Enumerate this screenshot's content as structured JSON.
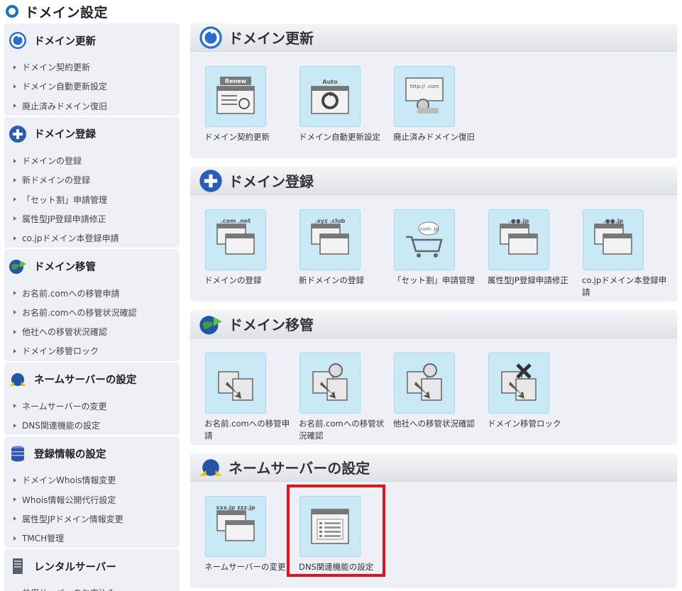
{
  "page_title": "ドメイン設定",
  "sidebar": {
    "sections": [
      {
        "title": "ドメイン更新",
        "icon": "renew-icon",
        "items": [
          "ドメイン契約更新",
          "ドメイン自動更新設定",
          "廃止済みドメイン復旧"
        ]
      },
      {
        "title": "ドメイン登録",
        "icon": "plus-icon",
        "items": [
          "ドメインの登録",
          "新ドメインの登録",
          "「セット割」申請管理",
          "属性型JP登録申請修正",
          "co.jpドメイン本登録申請"
        ]
      },
      {
        "title": "ドメイン移管",
        "icon": "globe-transfer-icon",
        "items": [
          "お名前.comへの移管申請",
          "お名前.comへの移管状況確認",
          "他社への移管状況確認",
          "ドメイン移管ロック"
        ]
      },
      {
        "title": "ネームサーバーの設定",
        "icon": "nameserver-icon",
        "items": [
          "ネームサーバーの変更",
          "DNS関連機能の設定"
        ]
      },
      {
        "title": "登録情報の設定",
        "icon": "database-icon",
        "items": [
          "ドメインWhois情報変更",
          "Whois情報公開代行設定",
          "属性型JPドメイン情報変更",
          "TMCH管理"
        ]
      },
      {
        "title": "レンタルサーバー",
        "icon": "server-icon",
        "items": [
          "共用サーバーのお申込み"
        ]
      }
    ]
  },
  "main": {
    "panels": [
      {
        "title": "ドメイン更新",
        "icon": "renew-icon",
        "tiles": [
          {
            "caption": "ドメイン契約更新",
            "icon": "renew-doc-icon",
            "thumb_text": "Renew"
          },
          {
            "caption": "ドメイン自動更新設定",
            "icon": "auto-renew-icon",
            "thumb_text": "Auto"
          },
          {
            "caption": "廃止済みドメイン復旧",
            "icon": "restore-domain-icon",
            "thumb_text": "http://  .com"
          }
        ]
      },
      {
        "title": "ドメイン登録",
        "icon": "plus-icon",
        "tiles": [
          {
            "caption": "ドメインの登録",
            "icon": "domain-register-icon",
            "thumb_text": ".com .net"
          },
          {
            "caption": "新ドメインの登録",
            "icon": "new-domain-icon",
            "thumb_text": ".xyz .club"
          },
          {
            "caption": "「セット割」申請管理",
            "icon": "cart-icon",
            "thumb_text": ".com .jp"
          },
          {
            "caption": "属性型JP登録申請修正",
            "icon": "jp-attr-icon",
            "thumb_text": ".●●.jp"
          },
          {
            "caption": "co.jpドメイン本登録申請",
            "icon": "cojp-icon",
            "thumb_text": ".●●.jp"
          }
        ]
      },
      {
        "title": "ドメイン移管",
        "icon": "globe-transfer-icon",
        "tiles": [
          {
            "caption": "お名前.comへの移管申請",
            "icon": "transfer-in-icon"
          },
          {
            "caption": "お名前.comへの移管状況確認",
            "icon": "transfer-status-icon"
          },
          {
            "caption": "他社への移管状況確認",
            "icon": "transfer-out-icon"
          },
          {
            "caption": "ドメイン移管ロック",
            "icon": "transfer-lock-icon"
          }
        ]
      },
      {
        "title": "ネームサーバーの設定",
        "icon": "nameserver-icon",
        "tiles": [
          {
            "caption": "ネームサーバーの変更",
            "icon": "nameserver-change-icon",
            "thumb_text": "xxx.jp zzz.jp"
          },
          {
            "caption": "DNS関連機能の設定",
            "icon": "dns-settings-icon"
          }
        ]
      }
    ]
  },
  "colors": {
    "accent": "#1e6fc8",
    "highlight": "#e0141c",
    "panel_bg": "#eef0f5",
    "thumb_bg": "#c9e9f7"
  }
}
